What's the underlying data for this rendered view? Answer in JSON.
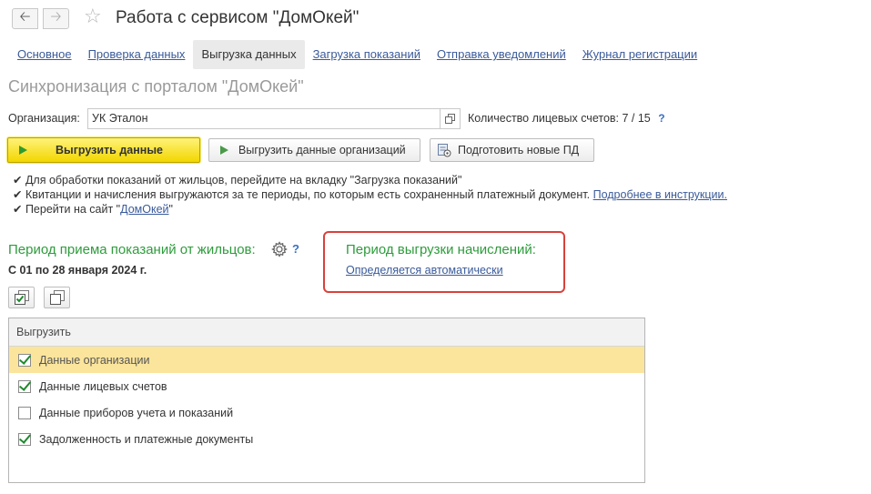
{
  "header": {
    "back_icon": "arrow-left-icon",
    "forward_icon": "arrow-right-icon",
    "favorite_icon": "star-icon",
    "title": "Работа с сервисом \"ДомОкей\""
  },
  "tabs": [
    {
      "label": "Основное",
      "active": false
    },
    {
      "label": "Проверка данных",
      "active": false
    },
    {
      "label": "Выгрузка данных",
      "active": true
    },
    {
      "label": "Загрузка показаний",
      "active": false
    },
    {
      "label": "Отправка уведомлений",
      "active": false
    },
    {
      "label": "Журнал регистрации",
      "active": false
    }
  ],
  "section_title": "Синхронизация с порталом \"ДомОкей\"",
  "organization": {
    "label": "Организация:",
    "value": "УК Эталон",
    "accounts_label": "Количество лицевых счетов: 7 / 15",
    "help": "?"
  },
  "buttons": {
    "upload": "Выгрузить данные",
    "upload_org": "Выгрузить данные организаций",
    "prepare": "Подготовить новые ПД"
  },
  "notes": {
    "n1": "✔ Для обработки показаний от жильцов, перейдите на вкладку \"Загрузка показаний\"",
    "n2": "✔ Квитанции и начисления выгружаются за те периоды, по которым есть сохраненный платежный документ.",
    "n2_link": "Подробнее в инструкции.",
    "n3_prefix": "✔ Перейти на сайт \"",
    "n3_link": "ДомОкей",
    "n3_suffix": "\""
  },
  "readings_period": {
    "title": "Период приема показаний от жильцов:",
    "help": "?",
    "value": "С 01 по 28 января 2024 г."
  },
  "charges_period": {
    "title": "Период выгрузки начислений:",
    "link": "Определяется автоматически"
  },
  "table": {
    "header": "Выгрузить",
    "rows": [
      {
        "label": "Данные организации",
        "checked": true
      },
      {
        "label": "Данные лицевых счетов",
        "checked": true
      },
      {
        "label": "Данные приборов учета и показаний",
        "checked": false
      },
      {
        "label": "Задолженность и платежные документы",
        "checked": true
      }
    ]
  },
  "colors": {
    "accent_green": "#2e9c3c",
    "link_blue": "#3a5a9a",
    "primary_button": "#f2d600",
    "highlight_box": "#d9413b",
    "selected_row": "#fbe59c"
  }
}
